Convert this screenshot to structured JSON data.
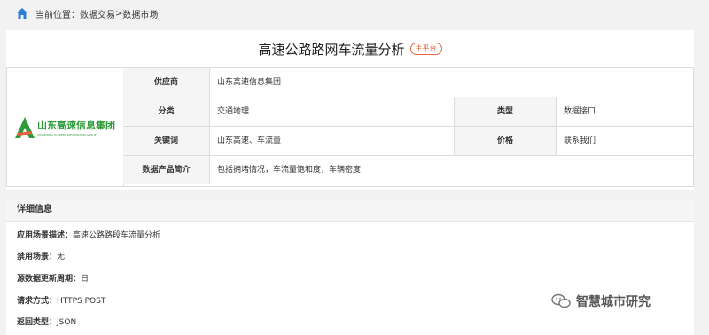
{
  "breadcrumb": {
    "prefix": "当前位置：",
    "items": [
      "数据交易",
      "数据市场"
    ],
    "separator": ">"
  },
  "product": {
    "title": "高速公路路网车流量分析",
    "badge": "主平台"
  },
  "logo": {
    "name": "山东高速信息集团",
    "subtitle": "SHANDONG HI-SPEED INFORMATION GROUP",
    "brand_color": "#2f9a3a"
  },
  "info": {
    "supplier_label": "供应商",
    "supplier_value": "山东高速信息集团",
    "category_label": "分类",
    "category_value": "交通地理",
    "type_label": "类型",
    "type_value": "数据接口",
    "keywords_label": "关键词",
    "keywords_value": "山东高速、车流量",
    "price_label": "价格",
    "price_value": "联系我们",
    "intro_label": "数据产品简介",
    "intro_value": "包括拥堵情况，车流量饱和度，车辆密度"
  },
  "details": {
    "title": "详细信息",
    "lines": [
      {
        "label": "应用场景描述：",
        "value": "高速公路路段车流量分析"
      },
      {
        "label": "禁用场景：",
        "value": "无"
      },
      {
        "label": "源数据更新周期：",
        "value": "日"
      },
      {
        "label": "请求方式：",
        "value": "HTTPS POST"
      },
      {
        "label": "返回类型：",
        "value": "JSON"
      }
    ]
  },
  "watermark": {
    "text": "智慧城市研究"
  },
  "colors": {
    "home_icon": "#2a7fd4",
    "badge": "#e8623c"
  }
}
